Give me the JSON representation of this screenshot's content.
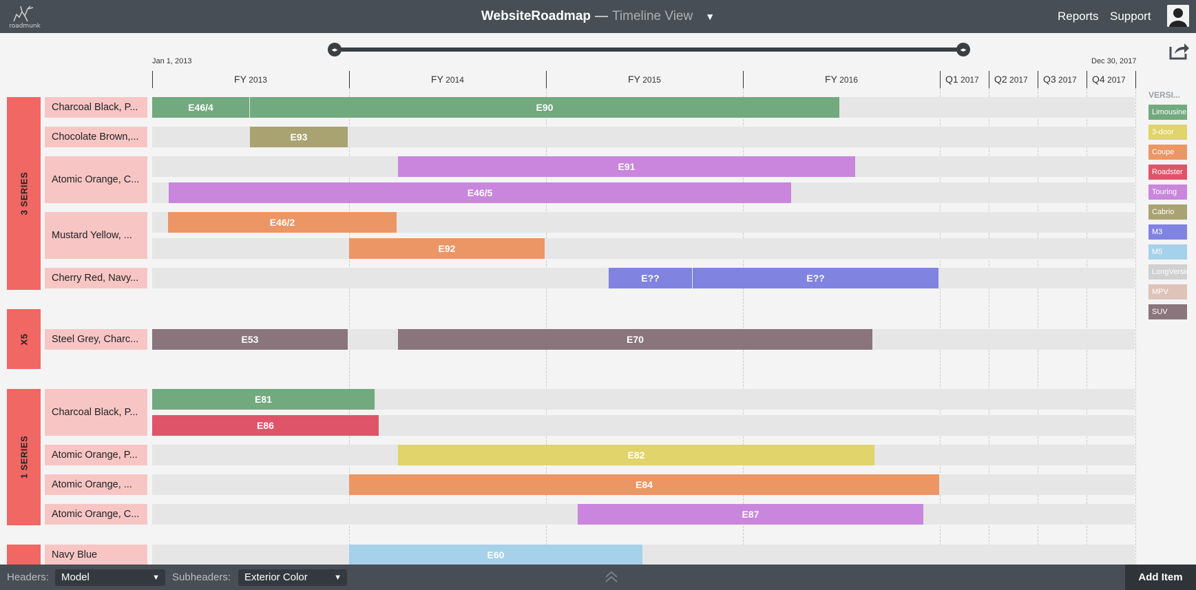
{
  "app": {
    "logo_text": "roadmunk",
    "title": "WebsiteRoadmap",
    "title_separator": "—",
    "view": "Timeline View",
    "nav": {
      "reports": "Reports",
      "support": "Support"
    }
  },
  "timeline": {
    "start_date": "Jan 1, 2013",
    "end_date": "Dec 30, 2017",
    "periods": [
      {
        "label": "FY",
        "year": "2013"
      },
      {
        "label": "FY",
        "year": "2014"
      },
      {
        "label": "FY",
        "year": "2015"
      },
      {
        "label": "FY",
        "year": "2016"
      },
      {
        "label": "Q1",
        "year": "2017"
      },
      {
        "label": "Q2",
        "year": "2017"
      },
      {
        "label": "Q3",
        "year": "2017"
      },
      {
        "label": "Q4",
        "year": "2017"
      }
    ]
  },
  "groups": [
    {
      "name": "3 SERIES",
      "rows": [
        {
          "label": "Charcoal Black, P...",
          "bars": [
            [
              {
                "text": "E46/4",
                "version": "Limousine"
              },
              {
                "text": "E90",
                "version": "Limousine"
              }
            ]
          ]
        },
        {
          "label": "Chocolate Brown,...",
          "bars": [
            [
              {
                "text": "E93",
                "version": "Cabrio"
              }
            ]
          ]
        },
        {
          "label": "Atomic Orange, C...",
          "bars": [
            [
              {
                "text": "E91",
                "version": "Touring"
              }
            ],
            [
              {
                "text": "E46/5",
                "version": "Touring"
              }
            ]
          ]
        },
        {
          "label": "Mustard Yellow, ...",
          "bars": [
            [
              {
                "text": "E46/2",
                "version": "Coupe"
              }
            ],
            [
              {
                "text": "E92",
                "version": "Coupe"
              }
            ]
          ]
        },
        {
          "label": "Cherry Red, Navy...",
          "bars": [
            [
              {
                "text": "E??",
                "version": "M3"
              },
              {
                "text": "E??",
                "version": "M3"
              }
            ]
          ]
        }
      ]
    },
    {
      "name": "X5",
      "rows": [
        {
          "label": "Steel Grey, Charc...",
          "bars": [
            [
              {
                "text": "E53",
                "version": "SUV"
              },
              {
                "text": "E70",
                "version": "SUV"
              }
            ]
          ]
        }
      ]
    },
    {
      "name": "1 SERIES",
      "rows": [
        {
          "label": "Charcoal Black, P...",
          "bars": [
            [
              {
                "text": "E81",
                "version": "Limousine"
              }
            ],
            [
              {
                "text": "E86",
                "version": "Roadster"
              }
            ]
          ]
        },
        {
          "label": "Atomic Orange, P...",
          "bars": [
            [
              {
                "text": "E82",
                "version": "3-door"
              }
            ]
          ]
        },
        {
          "label": "Atomic Orange, ...",
          "bars": [
            [
              {
                "text": "E84",
                "version": "Coupe"
              }
            ]
          ]
        },
        {
          "label": "Atomic Orange, C...",
          "bars": [
            [
              {
                "text": "E87",
                "version": "Touring"
              }
            ]
          ]
        }
      ]
    },
    {
      "name": "",
      "rows": [
        {
          "label": "Navy Blue",
          "bars": [
            [
              {
                "text": "E60",
                "version": "M5"
              }
            ]
          ]
        }
      ]
    }
  ],
  "legend": {
    "title": "VERSI...",
    "items": [
      {
        "label": "Limousine",
        "color": "#72a97f"
      },
      {
        "label": "3-door",
        "color": "#e0d46a"
      },
      {
        "label": "Coupe",
        "color": "#ec9665"
      },
      {
        "label": "Roadster",
        "color": "#e05469"
      },
      {
        "label": "Touring",
        "color": "#c986dc"
      },
      {
        "label": "Cabrio",
        "color": "#a8a371"
      },
      {
        "label": "M3",
        "color": "#8083e0"
      },
      {
        "label": "M5",
        "color": "#a5d1ea"
      },
      {
        "label": "LongVersion",
        "color": "#d0d0d0"
      },
      {
        "label": "MPV",
        "color": "#dfc3b9"
      },
      {
        "label": "SUV",
        "color": "#8a757c"
      }
    ]
  },
  "bottom": {
    "headers_label": "Headers:",
    "headers_value": "Model",
    "subheaders_label": "Subheaders:",
    "subheaders_value": "Exterior Color",
    "add_item": "Add Item"
  }
}
